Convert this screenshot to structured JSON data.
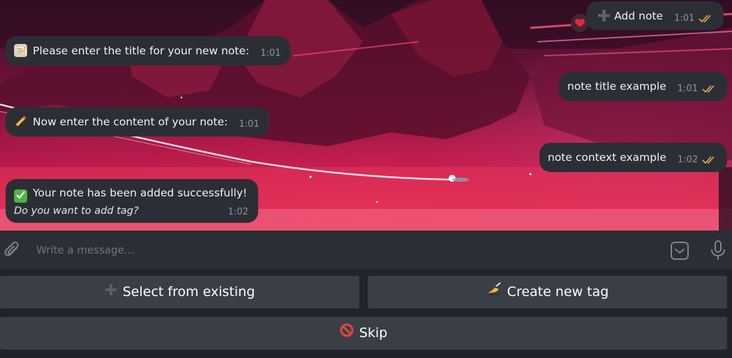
{
  "messages": [
    {
      "direction": "out",
      "text": "➕ Add note",
      "time": "1:01",
      "reaction": "heart"
    },
    {
      "direction": "in",
      "icon": "memo-icon",
      "text": "Please enter the title for your new note:",
      "time": "1:01"
    },
    {
      "direction": "out",
      "text": "note title example",
      "time": "1:01"
    },
    {
      "direction": "in",
      "icon": "pencil-icon",
      "text": "Now enter the content of your note:",
      "time": "1:01"
    },
    {
      "direction": "out",
      "text": "note context example",
      "time": "1:02"
    },
    {
      "direction": "in",
      "icon": "check-mark-icon",
      "text": "Your note has been added successfully!",
      "subtext": "Do you want to add tag?",
      "time": "1:02"
    }
  ],
  "input": {
    "placeholder": "Write a message..."
  },
  "keyboard": {
    "buttons": [
      {
        "label": "Select from existing",
        "icon": "plus-icon"
      },
      {
        "label": "Create new tag",
        "icon": "writing-hand-icon"
      },
      {
        "label": "Skip",
        "icon": "prohibited-icon"
      }
    ]
  },
  "colors": {
    "bubble": "#2b2f35",
    "read_checks": "#e8a856",
    "keyboard_button": "#3a3f46",
    "input_bar": "#2b2f35",
    "reaction_heart": "#e8243c"
  }
}
